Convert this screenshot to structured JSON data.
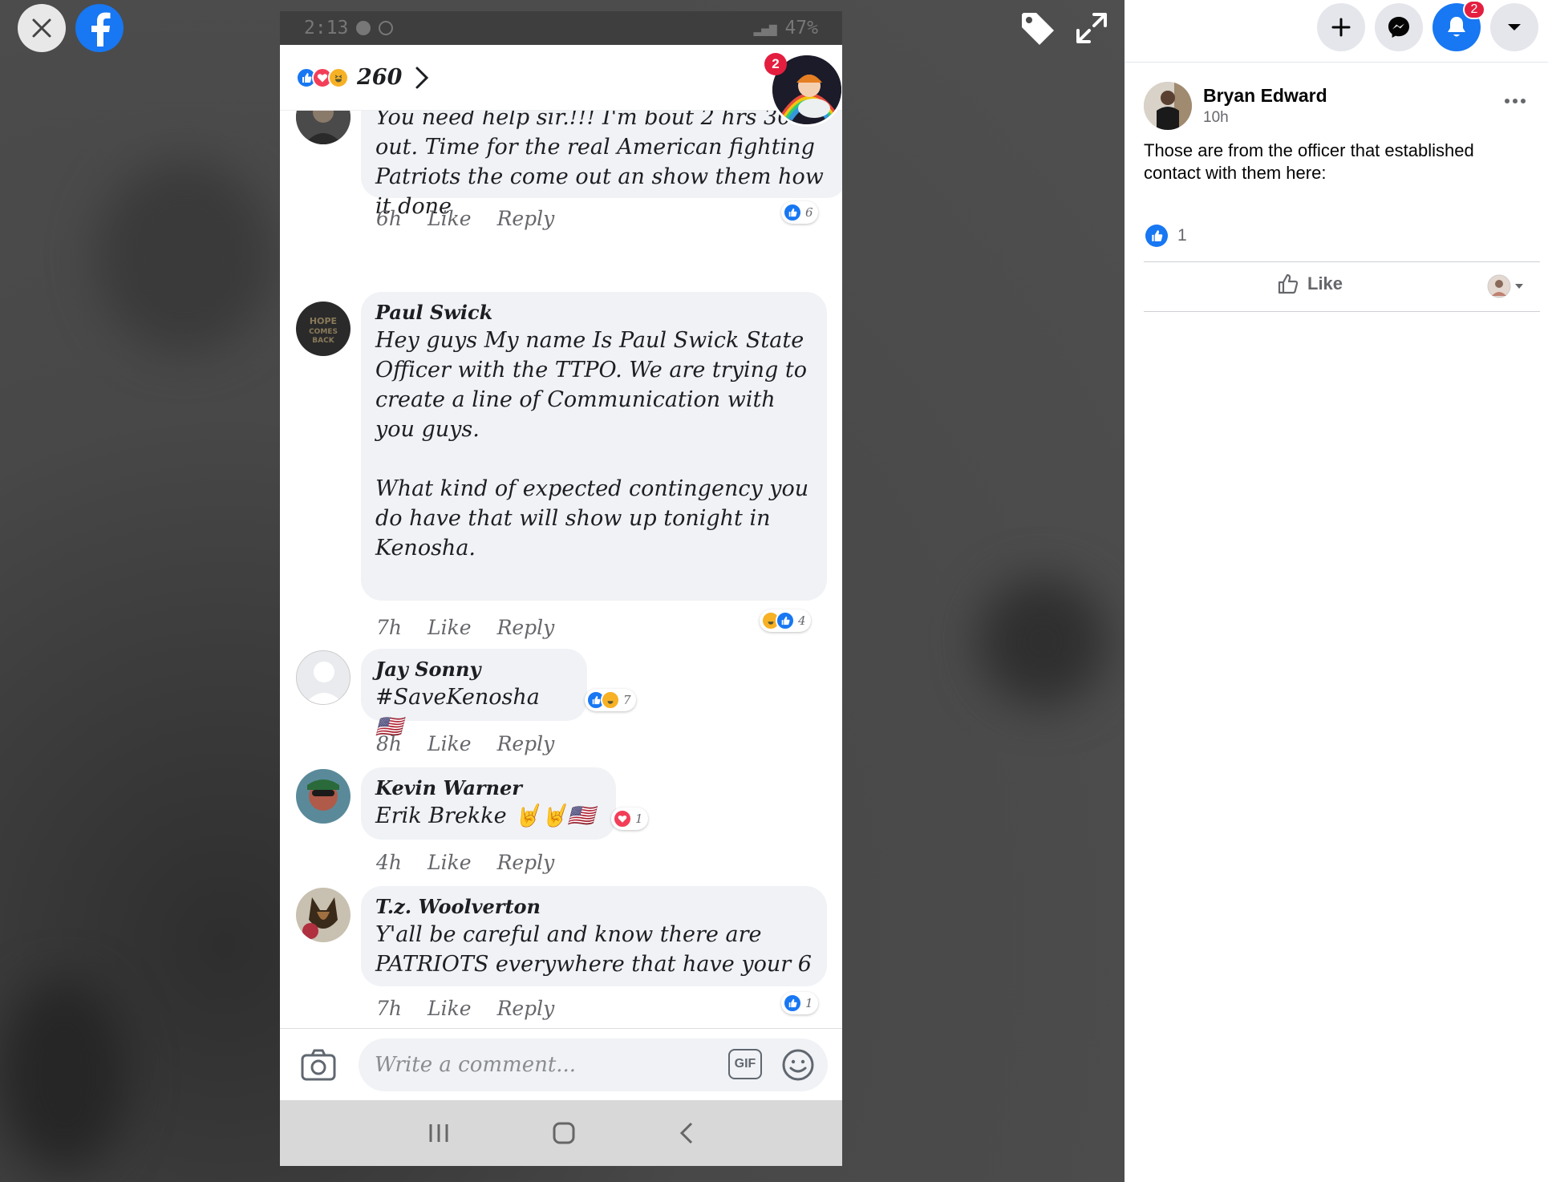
{
  "viewer": {
    "status_time": "2:13",
    "status_battery": "47%",
    "reaction_total": "260",
    "chathead_badge": "2",
    "comments": [
      {
        "name": "",
        "text": "You need help sir.!!! I'm bout 2 hrs 30 out. Time for the real American fighting Patriots the come out an show them how it done",
        "time": "6h",
        "like": "Like",
        "reply": "Reply",
        "reaction_count": "6"
      },
      {
        "name": "Paul Swick",
        "text": "Hey guys My name Is Paul Swick State Officer with the TTPO. We are trying to create a line of Communication with you guys.\n\nWhat kind of expected contingency you do have that will show up tonight in Kenosha.",
        "time": "7h",
        "like": "Like",
        "reply": "Reply",
        "reaction_count": "4",
        "avatar_text": "HOPE COMES BACK"
      },
      {
        "name": "Jay Sonny",
        "text": "#SaveKenosha 🇺🇸",
        "time": "8h",
        "like": "Like",
        "reply": "Reply",
        "reaction_count": "7"
      },
      {
        "name": "Kevin Warner",
        "text": "Erik Brekke 🤘🤘🇺🇸",
        "time": "4h",
        "like": "Like",
        "reply": "Reply",
        "reaction_count": "1"
      },
      {
        "name": "T.z. Woolverton",
        "text": "Y'all be careful and know there are PATRIOTS everywhere that have your 6",
        "time": "7h",
        "like": "Like",
        "reply": "Reply",
        "reaction_count": "1"
      }
    ],
    "composer_placeholder": "Write a comment...",
    "gif_label": "GIF"
  },
  "sidebar": {
    "notification_count": "2",
    "author": "Bryan Edward",
    "post_time": "10h",
    "post_text": "Those are from the officer that established contact with them here:",
    "like_count": "1",
    "like_label": "Like"
  },
  "colors": {
    "facebook_blue": "#1877f2",
    "love_red": "#f33e58",
    "haha_yellow": "#f7b125",
    "badge_red": "#e41e3f"
  },
  "icons": [
    "close-icon",
    "facebook-logo-icon",
    "tag-icon",
    "expand-icon",
    "plus-icon",
    "messenger-icon",
    "bell-icon",
    "caret-down-icon",
    "more-icon",
    "like-thumb-icon",
    "camera-icon",
    "emoji-icon"
  ]
}
